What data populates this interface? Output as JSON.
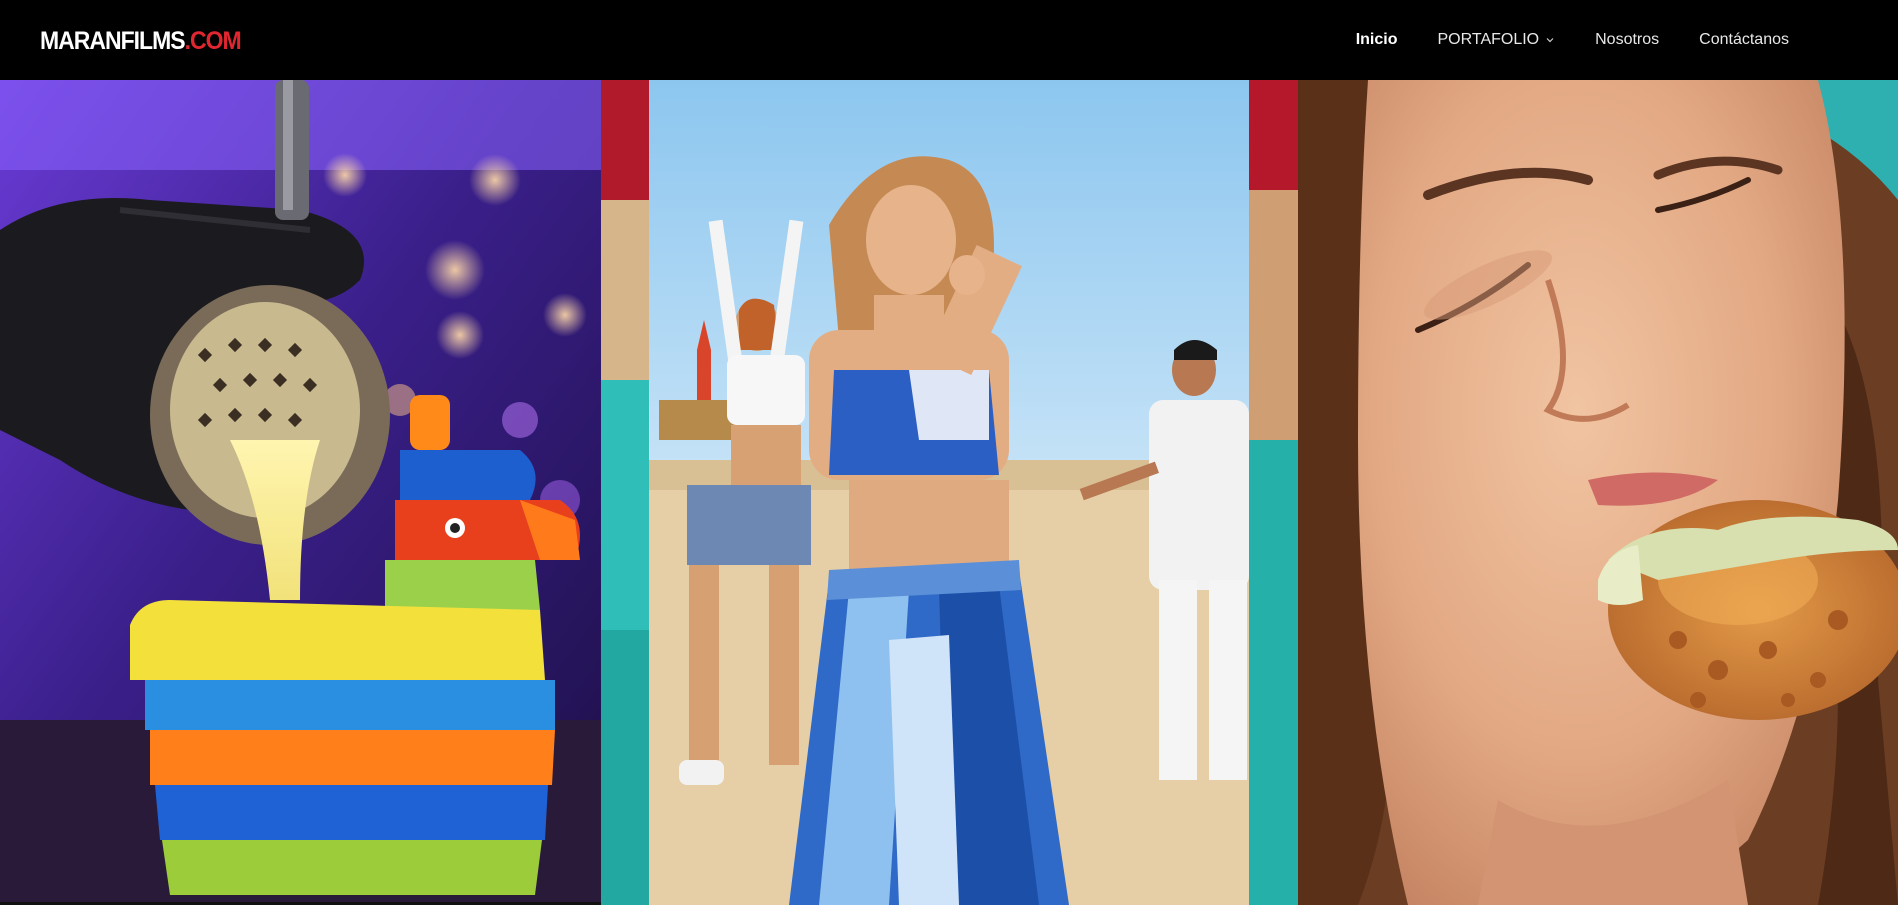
{
  "brand": {
    "logo_main": "MARANFILMS",
    "logo_tld": ".COM",
    "accent_color": "#e0262f"
  },
  "nav": {
    "items": [
      {
        "label": "Inicio",
        "active": true
      },
      {
        "label": "PORTAFOLIO",
        "has_dropdown": true
      },
      {
        "label": "Nosotros"
      },
      {
        "label": "Contáctanos"
      }
    ]
  },
  "hero": {
    "panels": [
      {
        "subject": "cocktail-pour-pinata-glass"
      },
      {
        "subject": "beach-dance-music-video"
      },
      {
        "subject": "woman-eating-fried-chicken"
      }
    ]
  }
}
